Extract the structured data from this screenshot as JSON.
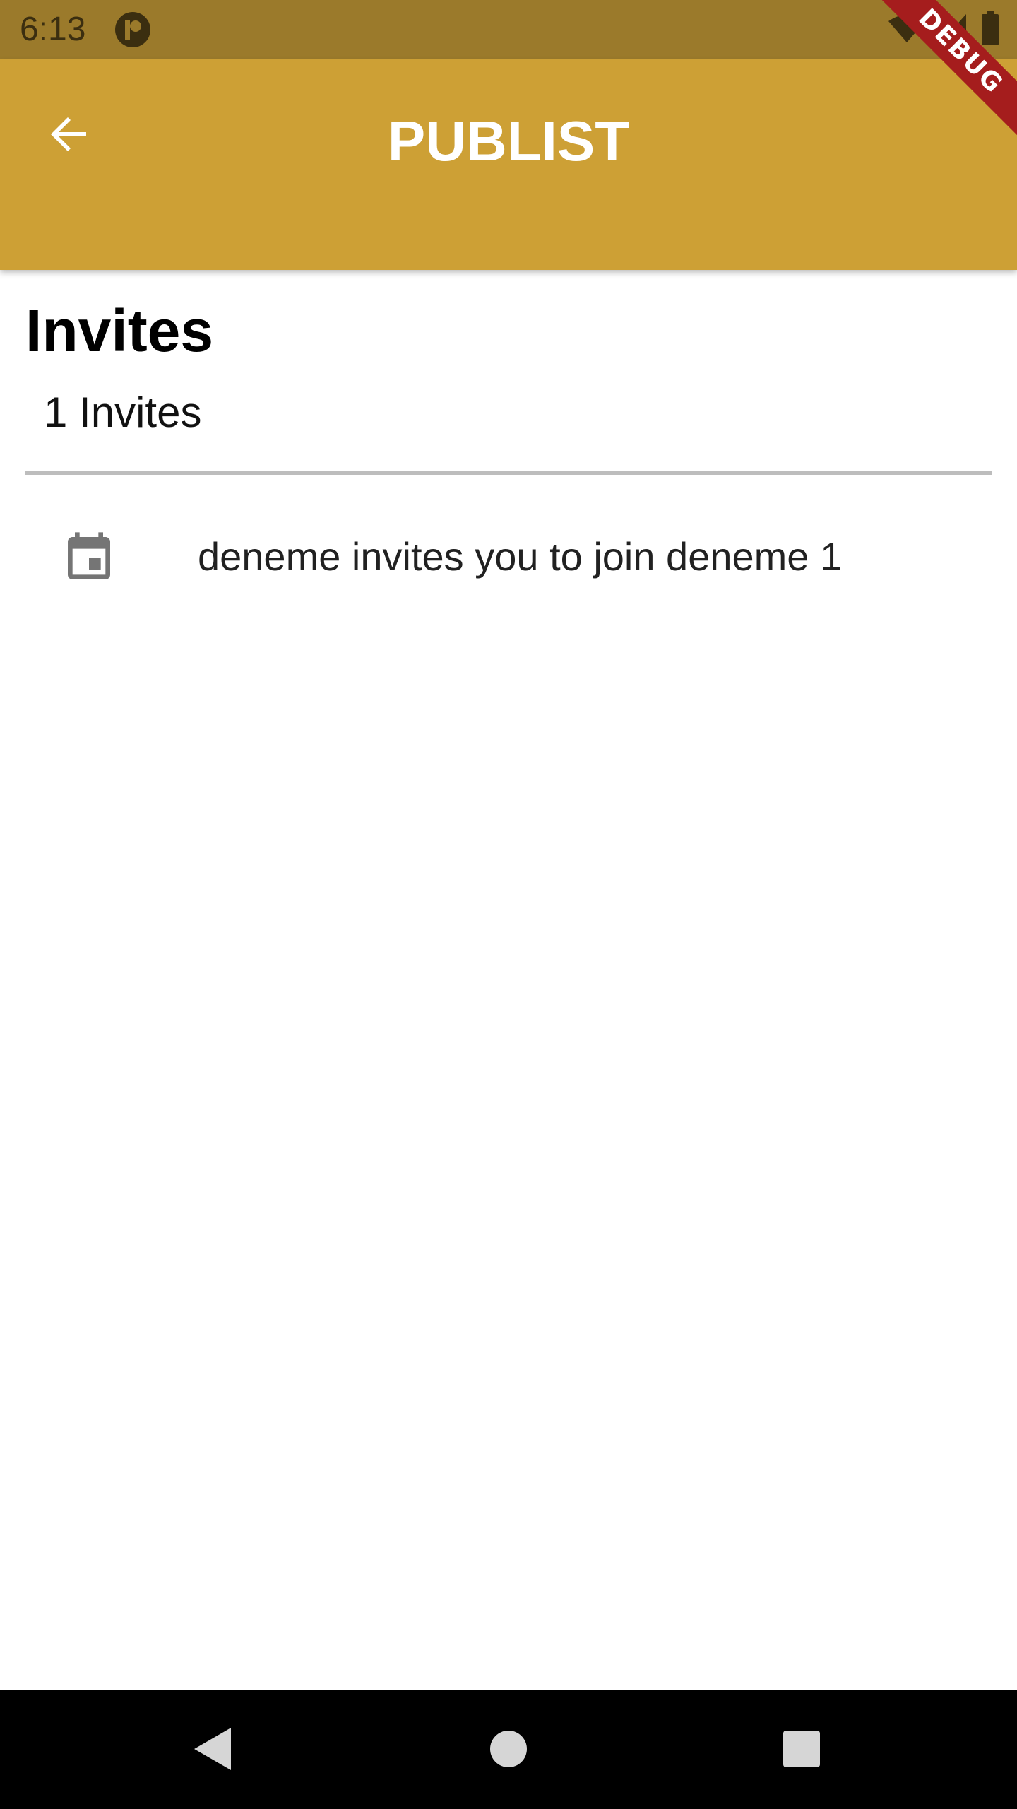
{
  "status_bar": {
    "time": "6:13",
    "icons": [
      "app-notification-icon",
      "wifi-icon",
      "signal-icon",
      "battery-icon"
    ]
  },
  "debug_banner": {
    "label": "DEBUG",
    "color": "#a51d1d"
  },
  "app_bar": {
    "title": "PUBLIST",
    "back_icon": "arrow-back-icon",
    "color": "#cda035"
  },
  "page": {
    "heading": "Invites",
    "count_text": "1 Invites"
  },
  "invites": [
    {
      "icon": "calendar-event-icon",
      "text": "deneme invites you to join deneme 1"
    }
  ],
  "nav_bar": {
    "buttons": [
      "back-triangle-icon",
      "home-circle-icon",
      "recents-square-icon"
    ]
  }
}
